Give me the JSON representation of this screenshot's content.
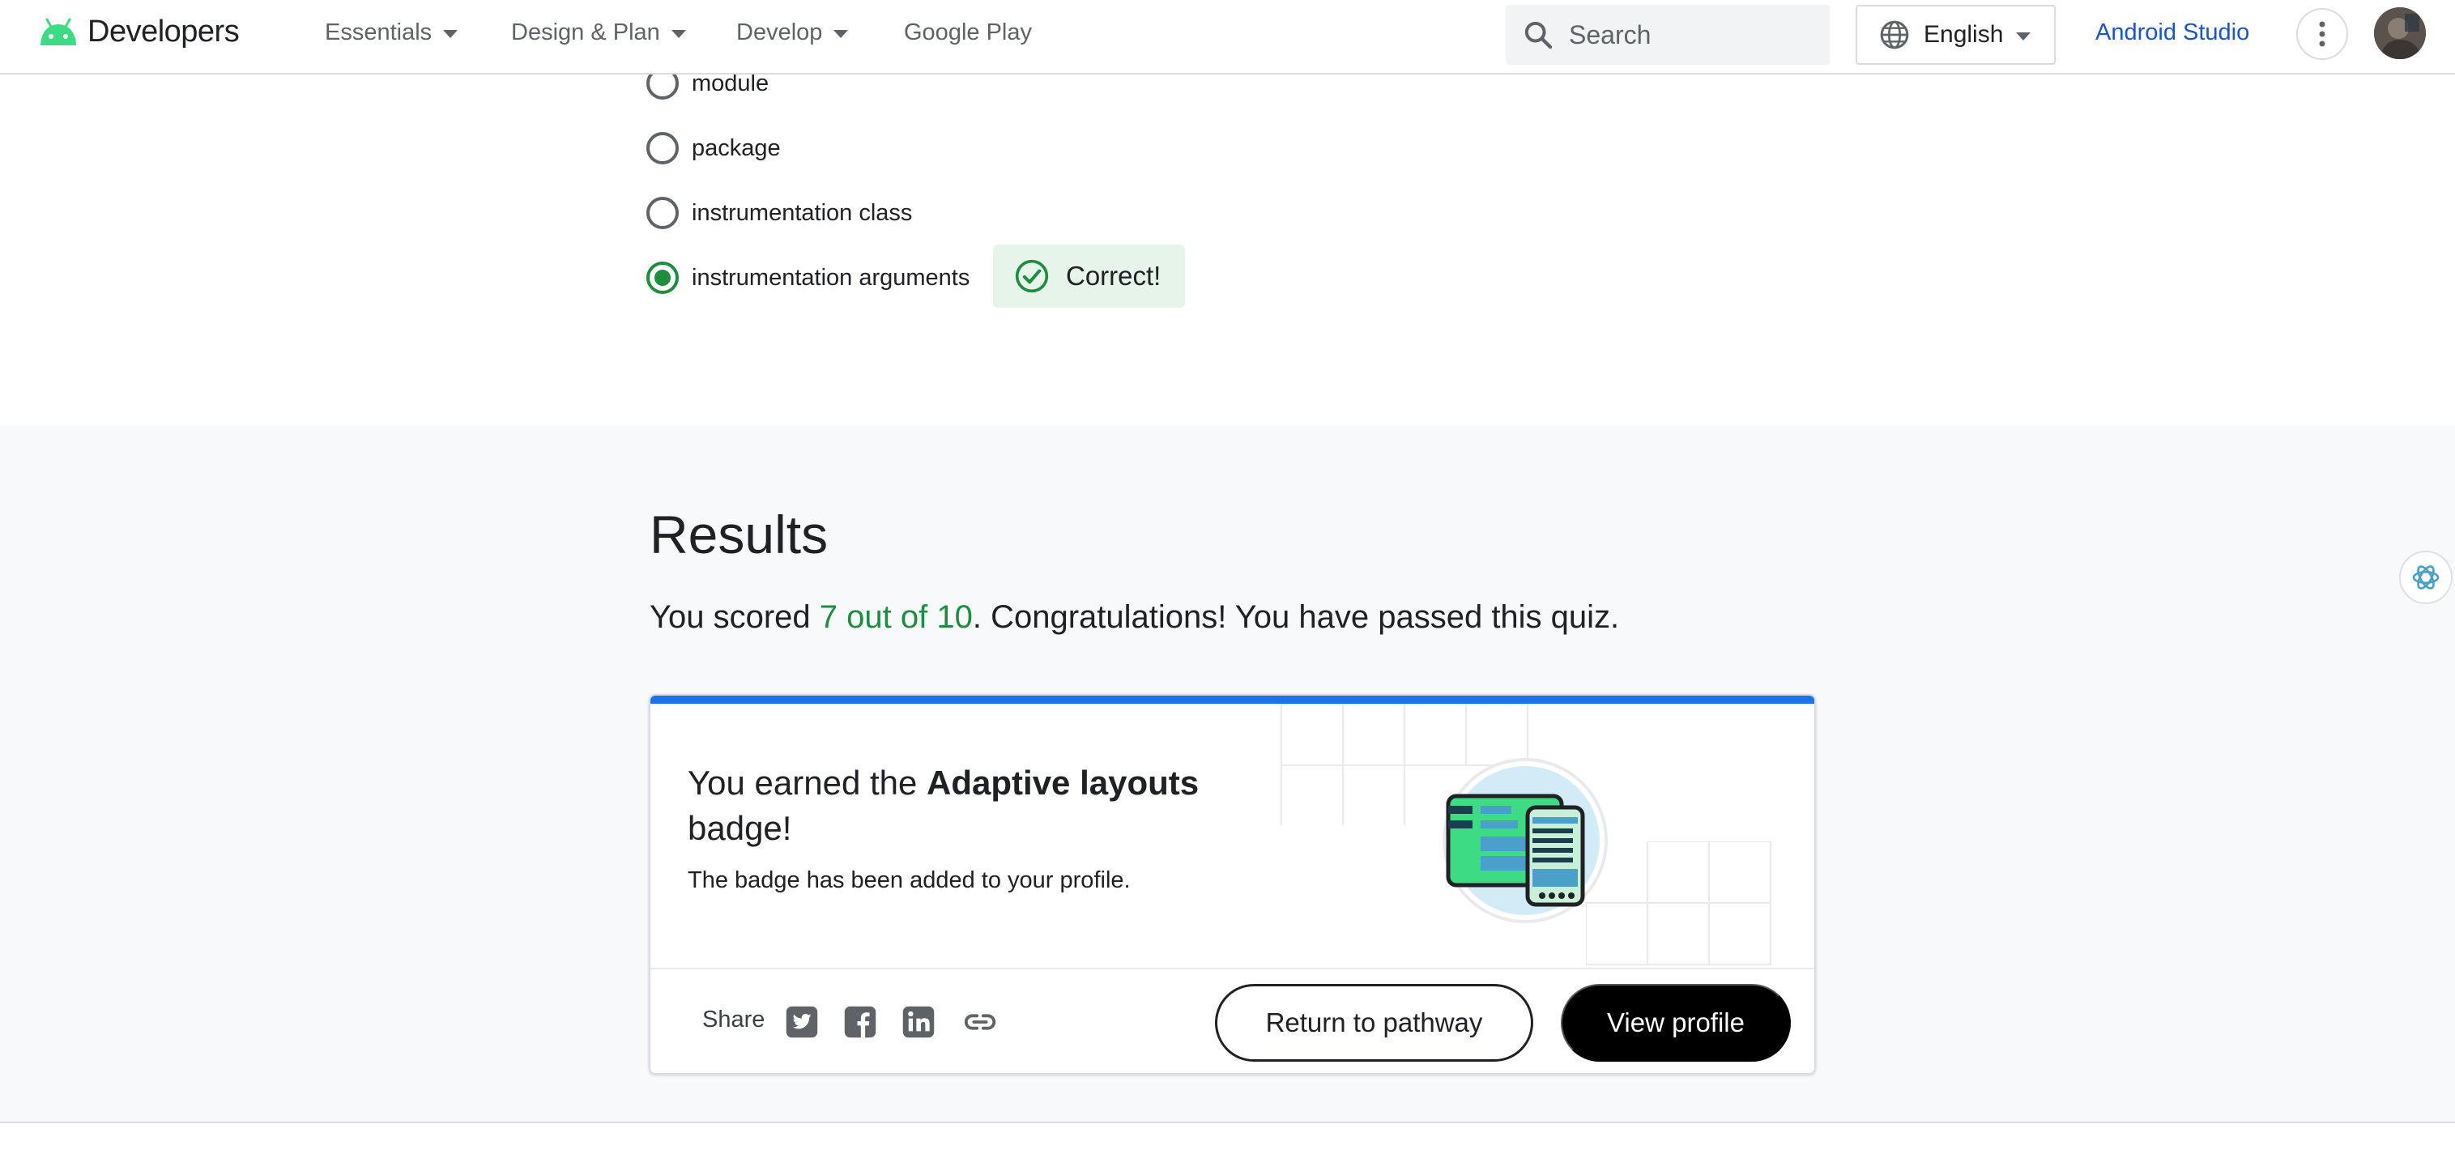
{
  "header": {
    "logo_text": "Developers",
    "nav": [
      "Essentials",
      "Design & Plan",
      "Develop",
      "Google Play"
    ],
    "search_placeholder": "Search",
    "language": "English",
    "android_studio": "Android Studio"
  },
  "quiz": {
    "options": [
      {
        "label": "module",
        "selected": false
      },
      {
        "label": "package",
        "selected": false
      },
      {
        "label": "instrumentation class",
        "selected": false
      },
      {
        "label": "instrumentation arguments",
        "selected": true
      }
    ],
    "feedback": "Correct!"
  },
  "results": {
    "title": "Results",
    "score_prefix": "You scored ",
    "score": "7 out of 10",
    "score_suffix": ". Congratulations! You have passed this quiz."
  },
  "badge_card": {
    "earned_prefix": "You earned the ",
    "badge_name": "Adaptive layouts",
    "earned_suffix": "badge!",
    "added_text": "The badge has been added to your profile.",
    "share_label": "Share",
    "return_button": "Return to pathway",
    "view_profile_button": "View profile"
  },
  "colors": {
    "accent_blue": "#1a73e8",
    "correct_green": "#1e8e3e",
    "link_blue": "#1a56c4"
  }
}
